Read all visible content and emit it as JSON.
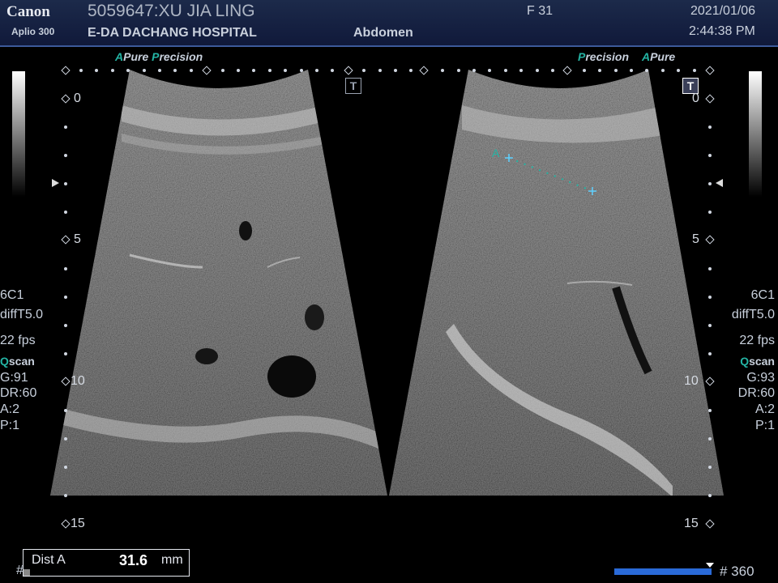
{
  "header": {
    "brand": "Canon",
    "model": "Aplio 300",
    "patient": "5059647:XU JIA LING",
    "hospital": "E-DA DACHANG HOSPITAL",
    "exam": "Abdomen",
    "sex_age": "F  31",
    "date": "2021/01/06",
    "time": "2:44:38 PM"
  },
  "left_panel": {
    "mode_a": "A",
    "mode_pure": "Pure",
    "mode_p": "P",
    "mode_recision": "recision",
    "probe": "6C1",
    "diff": "diffT5.0",
    "fps": "22 fps",
    "qscan_q": "Q",
    "qscan_rest": "scan",
    "gain": "G:91",
    "dr": "DR:60",
    "a": "A:2",
    "p": "P:1"
  },
  "right_panel": {
    "mode_p": "P",
    "mode_recision": "recision",
    "mode_a": "A",
    "mode_pure": "Pure",
    "probe": "6C1",
    "diff": "diffT5.0",
    "fps": "22 fps",
    "qscan_q": "Q",
    "qscan_rest": "scan",
    "gain": "G:93",
    "dr": "DR:60",
    "a": "A:2",
    "p": "P:1"
  },
  "depth_labels": [
    "0",
    "5",
    "10",
    "15"
  ],
  "t_marker": "T",
  "measurement": {
    "marker": "A",
    "label": "Dist A",
    "value": "31.6",
    "unit": "mm"
  },
  "footer": {
    "hash": "#",
    "frames": "# 360"
  },
  "colors": {
    "accent_teal": "#24b4a4",
    "header_bg": "#1c2a4a",
    "cine_bar": "#2a6ad8"
  },
  "icons": {
    "focus_marker": "triangle-pointer-icon",
    "t_box": "t-marker-icon"
  }
}
